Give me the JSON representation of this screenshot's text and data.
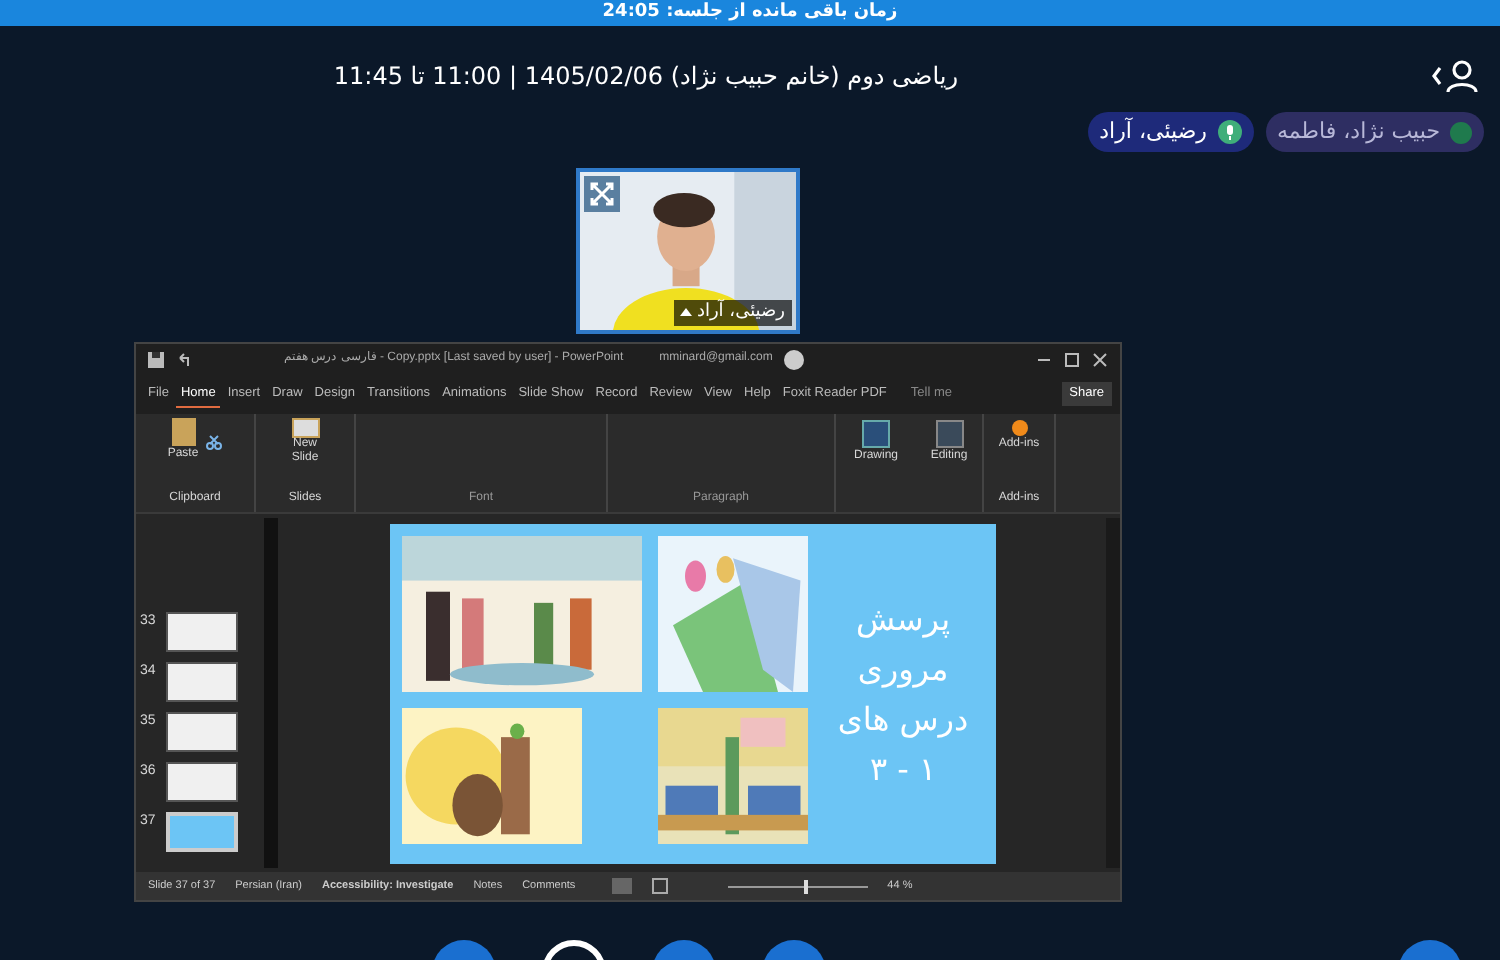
{
  "banner": {
    "text": "زمان باقی مانده از جلسه: 24:05"
  },
  "session": {
    "title": "ریاضی دوم (خانم حبیب نژاد) 1405/02/06 | 11:00 تا 11:45"
  },
  "participants": [
    {
      "name": "حبیب نژاد، فاطمه",
      "kind": "dot",
      "color": "#1f7a4d"
    },
    {
      "name": "رضیئی، آراد",
      "kind": "mic"
    }
  ],
  "video": {
    "name": "رضیئی، آراد"
  },
  "powerpoint": {
    "title": "فارسی درس هفتم - Copy.pptx [Last saved by user] - PowerPoint",
    "account": "mminard@gmail.com",
    "tabs": [
      {
        "label": "File",
        "selected": false
      },
      {
        "label": "Home",
        "selected": true
      },
      {
        "label": "Insert",
        "selected": false
      },
      {
        "label": "Draw",
        "selected": false
      },
      {
        "label": "Design",
        "selected": false
      },
      {
        "label": "Transitions",
        "selected": false
      },
      {
        "label": "Animations",
        "selected": false
      },
      {
        "label": "Slide Show",
        "selected": false
      },
      {
        "label": "Record",
        "selected": false
      },
      {
        "label": "Review",
        "selected": false
      },
      {
        "label": "View",
        "selected": false
      },
      {
        "label": "Help",
        "selected": false
      },
      {
        "label": "Foxit Reader PDF",
        "selected": false
      }
    ],
    "tell_me": "Tell me",
    "share": "Share",
    "ribbon": {
      "paste": "Paste",
      "new_slide": [
        "New",
        "Slide"
      ],
      "drawing": "Drawing",
      "editing": "Editing",
      "addins": "Add-ins",
      "groups": [
        "Clipboard",
        "Slides",
        "Font",
        "Paragraph",
        "Add-ins"
      ]
    },
    "thumbnails": [
      {
        "number": "33",
        "selected": false
      },
      {
        "number": "34",
        "selected": false
      },
      {
        "number": "35",
        "selected": false
      },
      {
        "number": "36",
        "selected": false
      },
      {
        "number": "37",
        "selected": true
      }
    ],
    "slide": {
      "lines": [
        "پرسش",
        "مروری",
        "درس های",
        "۱ - ۳"
      ]
    },
    "status": {
      "slide": "Slide 37 of 37",
      "language": "Persian (Iran)",
      "accessibility": "Accessibility: Investigate",
      "notes": "Notes",
      "comments": "Comments",
      "zoom": "44 %",
      "level": 0.55
    }
  }
}
